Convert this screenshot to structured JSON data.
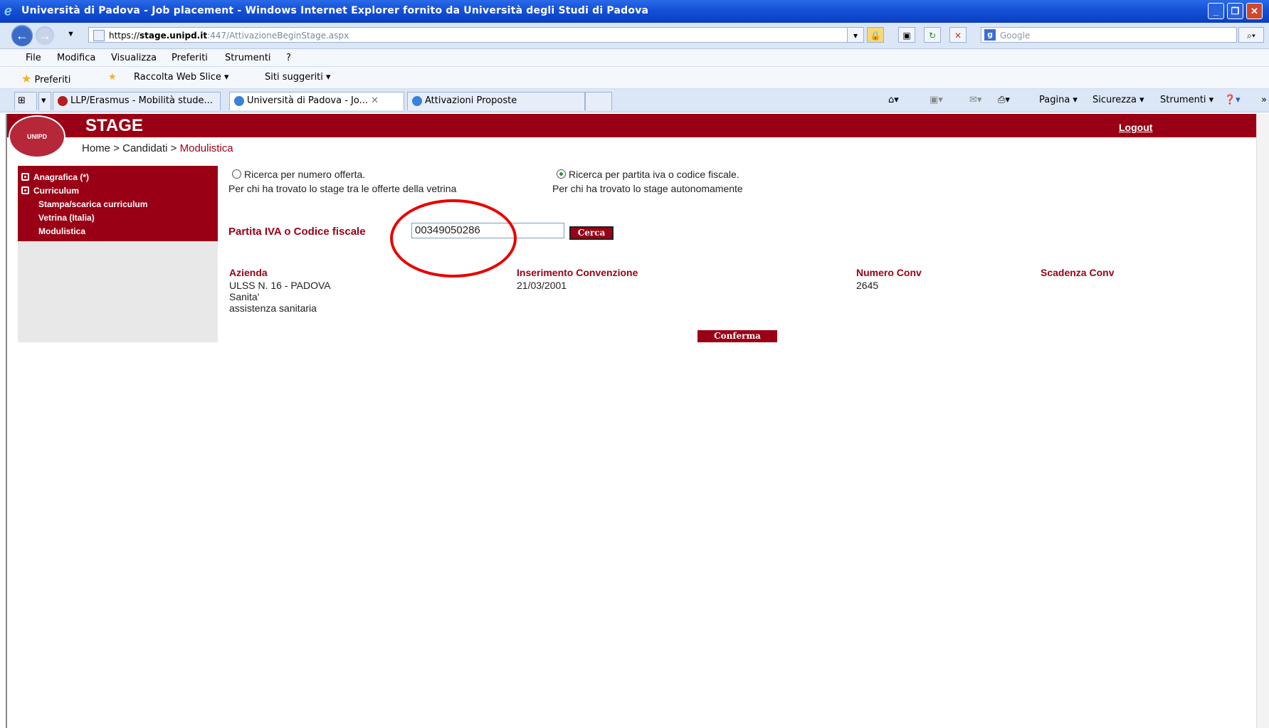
{
  "window": {
    "title": "Università di Padova - Job placement - Windows Internet Explorer fornito da Università degli Studi di Padova",
    "min": "_",
    "max": "❐",
    "close": "✕"
  },
  "address": {
    "prefix": "https://",
    "host": "stage.unipd.it",
    "rest": ":447/AttivazioneBeginStage.aspx",
    "search_placeholder": "Google"
  },
  "menu": [
    "File",
    "Modifica",
    "Visualizza",
    "Preferiti",
    "Strumenti",
    "?"
  ],
  "favorites": {
    "preferiti": "Preferiti",
    "web_slice": "Raccolta Web Slice ▾",
    "siti": "Siti suggeriti ▾"
  },
  "tabs": [
    {
      "label": "LLP/Erasmus - Mobilità stude..."
    },
    {
      "label": "Università di Padova - Jo..."
    },
    {
      "label": "Attivazioni Proposte"
    }
  ],
  "commands": {
    "pagina": "Pagina ▾",
    "sicurezza": "Sicurezza ▾",
    "strumenti": "Strumenti ▾"
  },
  "site": {
    "header_title": "STAGE",
    "logout": "Logout",
    "breadcrumb": {
      "home": "Home",
      "candidati": "Candidati",
      "current": "Modulistica",
      "sep": " > "
    },
    "sidebar": [
      {
        "label": "Anagrafica (*)",
        "bullet": true
      },
      {
        "label": "Curriculum",
        "bullet": true
      },
      {
        "label": "Stampa/scarica curriculum",
        "bullet": false
      },
      {
        "label": "Vetrina (Italia)",
        "bullet": false
      },
      {
        "label": "Modulistica",
        "bullet": false
      }
    ],
    "search_options": {
      "opt1_label": "Ricerca per numero offerta.",
      "opt1_desc": "Per chi ha trovato lo stage tra le offerte della vetrina",
      "opt2_label": "Ricerca per partita iva o codice fiscale.",
      "opt2_desc": "Per chi ha trovato lo stage autonomamente",
      "selected": 2
    },
    "piva_label": "Partita IVA o Codice fiscale",
    "piva_value": "00349050286",
    "cerca": "Cerca",
    "results_headers": {
      "azienda": "Azienda",
      "inserimento": "Inserimento Convenzione",
      "numero": "Numero Conv",
      "scadenza": "Scadenza Conv"
    },
    "result": {
      "azienda_name": "ULSS N. 16 - PADOVA",
      "azienda_line2": "Sanita'",
      "azienda_line3": "assistenza sanitaria",
      "inserimento": "21/03/2001",
      "numero": "2645",
      "scadenza": ""
    },
    "conferma": "Conferma"
  },
  "colors": {
    "brand": "#9a0015",
    "highlight": "#e80000"
  }
}
